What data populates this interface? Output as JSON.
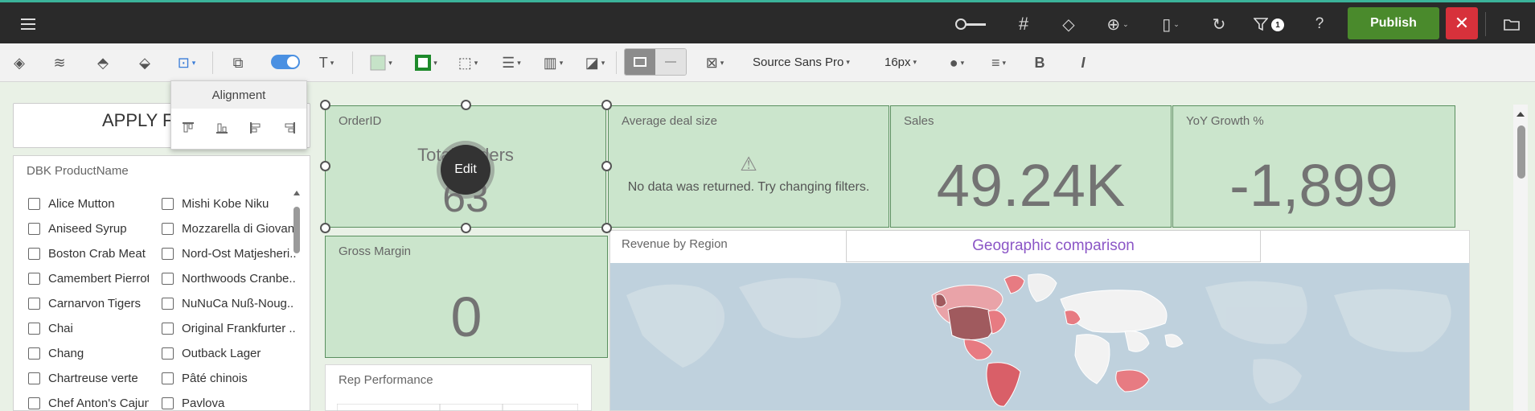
{
  "topbar": {
    "publish_label": "Publish",
    "filter_badge": "1",
    "icons": [
      "menu-icon",
      "timeline-icon",
      "grid-icon",
      "diamond-icon",
      "add-icon",
      "sheet-icon",
      "history-icon",
      "filter-icon",
      "help-icon",
      "close-icon",
      "folder-icon"
    ]
  },
  "toolbar": {
    "font_family": "Source Sans Pro",
    "font_size": "16px",
    "fill_color": "#c6e3c8",
    "border_color": "#1e8a2b"
  },
  "alignment_popup": {
    "title": "Alignment"
  },
  "filter": {
    "apply_label": "APPLY FI",
    "title": "DBK ProductName",
    "col1": [
      "Alice Mutton",
      "Aniseed Syrup",
      "Boston Crab Meat",
      "Camembert Pierrot",
      "Carnarvon Tigers",
      "Chai",
      "Chang",
      "Chartreuse verte",
      "Chef Anton's Cajun ..."
    ],
    "col2": [
      "Mishi Kobe Niku",
      "Mozzarella di Giovan",
      "Nord-Ost Matjesheri..",
      "Northwoods Cranbe..",
      "NuNuCa Nuß-Noug..",
      "Original Frankfurter ..",
      "Outback Lager",
      "Pâté chinois",
      "Pavlova"
    ]
  },
  "cards": {
    "order": {
      "title": "OrderID",
      "subtitle": "Total Orders",
      "value": "63",
      "edit_label": "Edit"
    },
    "deal": {
      "title": "Average deal size",
      "message": "No data was returned. Try changing filters."
    },
    "sales": {
      "title": "Sales",
      "value": "49.24K"
    },
    "yoy": {
      "title": "YoY Growth %",
      "value": "-1,899"
    },
    "margin": {
      "title": "Gross Margin",
      "value": "0"
    }
  },
  "map": {
    "title": "Revenue by Region",
    "geo_title": "Geographic comparison"
  },
  "rep": {
    "title": "Rep Performance"
  },
  "colors": {
    "accent": "#4a8a2c",
    "close": "#d7313b",
    "card_bg": "#cbe5cc",
    "map_water": "#bfd1dd"
  }
}
